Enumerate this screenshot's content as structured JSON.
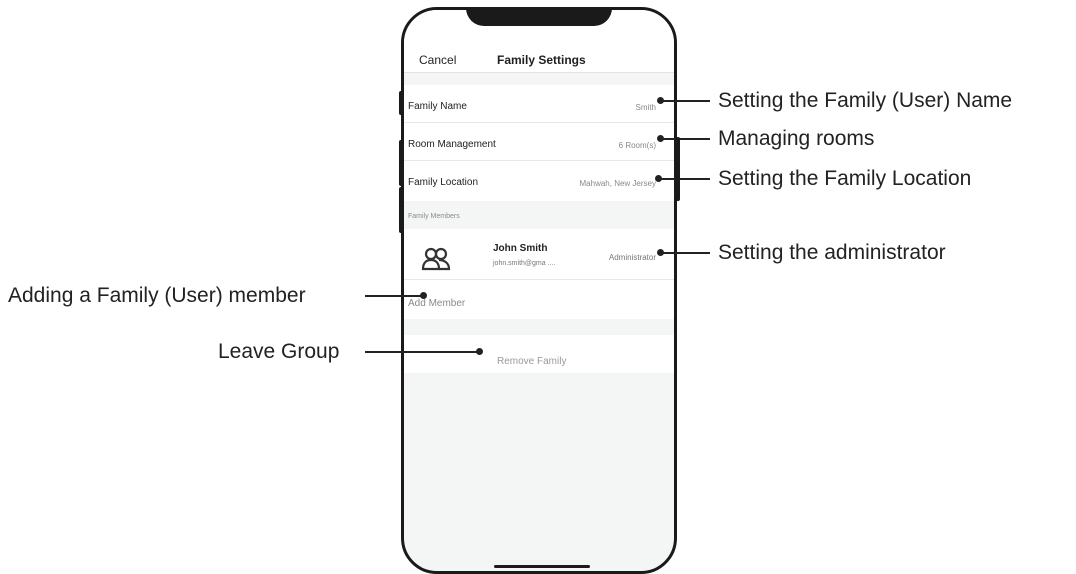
{
  "nav": {
    "cancel": "Cancel",
    "title": "Family Settings"
  },
  "settings": {
    "family_name": {
      "label": "Family Name",
      "value": "Smith"
    },
    "room_management": {
      "label": "Room Management",
      "value": "6 Room(s)"
    },
    "family_location": {
      "label": "Family Location",
      "value": "Mahwah, New Jersey"
    }
  },
  "members": {
    "section_label": "Family Members",
    "items": [
      {
        "name": "John Smith",
        "email": "john.smith@gma ....",
        "role": "Administrator",
        "icon": "family-members-icon"
      }
    ],
    "add_label": "Add Member"
  },
  "remove_label": "Remove Family",
  "callouts": {
    "family_name": "Setting the Family (User) Name",
    "rooms": "Managing rooms",
    "location": "Setting the Family Location",
    "administrator": "Setting the administrator",
    "add_member": "Adding a Family (User) member",
    "leave_group": "Leave Group"
  }
}
